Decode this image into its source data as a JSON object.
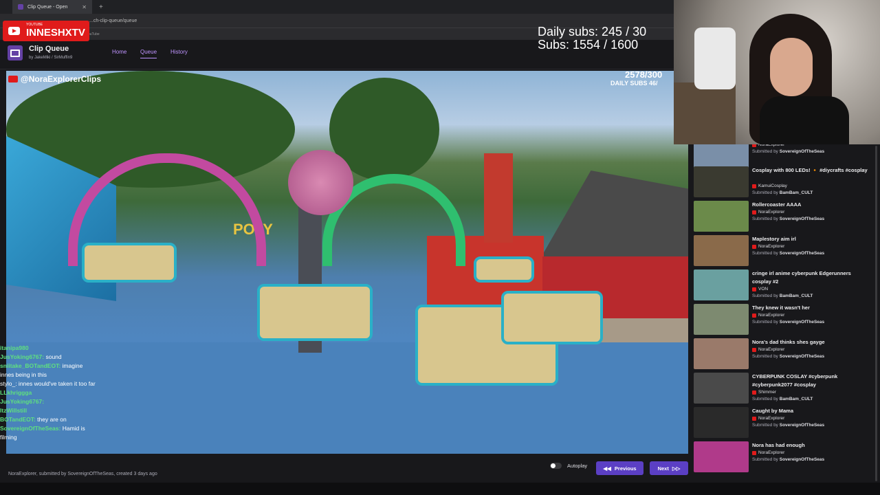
{
  "browser": {
    "tab_title": "Clip Queue - Open",
    "url": "...ch-clip-queue/queue",
    "bookmark": "YouTube"
  },
  "overlay": {
    "yt_small": "YOUTUBE",
    "yt_channel": "INNESHXTV",
    "daily_subs": "Daily subs: 245 / 30",
    "subs": "Subs: 1554 / 1600"
  },
  "app": {
    "title": "Clip Queue",
    "by_prefix": "by",
    "author1": "JakeMiki",
    "author2": "SirMuffin9",
    "nav": {
      "home": "Home",
      "queue": "Queue",
      "history": "History"
    }
  },
  "video": {
    "handle": "@NoraExplorerClips",
    "counter": "2578/300",
    "daily": "DAILY SUBS 46/",
    "sign": "POLY"
  },
  "chat": [
    {
      "user": "itanipa980",
      "text": ""
    },
    {
      "user": "JusYoking6767:",
      "text": "sound"
    },
    {
      "user": "sniitake_BOTandEOT:",
      "text": "imagine"
    },
    {
      "user": "",
      "text": "innes being in this"
    },
    {
      "user": "",
      "text": "stylo_: innes would've taken it too far"
    },
    {
      "user": "LLkhriggga",
      "text": ""
    },
    {
      "user": "JusYoking6767:",
      "text": ""
    },
    {
      "user": "ItzWillstill",
      "text": ""
    },
    {
      "user": "BOTandEOT:",
      "text": "they are on"
    },
    {
      "user": "SovereignOfTheSeas:",
      "text": "Hamid is"
    },
    {
      "user": "",
      "text": "filming"
    }
  ],
  "player": {
    "submitted_line": "NoraExplorer, submitted by SovereignOfTheSeas, created 3 days ago",
    "autoplay": "Autoplay",
    "previous": "Previous",
    "next": "Next"
  },
  "queue": [
    {
      "title": "",
      "channel": "NoraExplorer",
      "submitted_by": "SovereignOfTheSeas",
      "thumb": "#7a8fa8"
    },
    {
      "title": "Cosplay with 800 LEDs! 🔸 #diycrafts #cosplay",
      "channel": "KamuiCosplay",
      "submitted_by": "BamBam_CULT",
      "thumb": "#3a3a30"
    },
    {
      "title": "Rollercoaster AAAA",
      "channel": "NoraExplorer",
      "submitted_by": "SovereignOfTheSeas",
      "thumb": "#6b8a4a"
    },
    {
      "title": "Maplestory aim irl",
      "channel": "NoraExplorer",
      "submitted_by": "SovereignOfTheSeas",
      "thumb": "#8a6a4a"
    },
    {
      "title": "cringe irl anime cyberpunk Edgerunners cosplay #2",
      "channel": "VON",
      "submitted_by": "BamBam_CULT",
      "thumb": "#6aa0a0"
    },
    {
      "title": "They knew it wasn't her",
      "channel": "NoraExplorer",
      "submitted_by": "SovereignOfTheSeas",
      "thumb": "#7d8a70"
    },
    {
      "title": "Nora's dad thinks shes gayge",
      "channel": "NoraExplorer",
      "submitted_by": "SovereignOfTheSeas",
      "thumb": "#9a7a6a"
    },
    {
      "title": "CYBERPUNK COSLAY #cyberpunk #cyberpunk2077 #cosplay",
      "channel": "Shimmer",
      "submitted_by": "BamBam_CULT",
      "thumb": "#4a4a4a"
    },
    {
      "title": "Caught by Mama",
      "channel": "NoraExplorer",
      "submitted_by": "SovereignOfTheSeas",
      "thumb": "#2a2a2a"
    },
    {
      "title": "Nora has had enough",
      "channel": "NoraExplorer",
      "submitted_by": "SovereignOfTheSeas",
      "thumb": "#b03a8a"
    }
  ],
  "labels": {
    "submitted_by": "Submitted by"
  },
  "colors": {
    "accent": "#5b3fc4",
    "brand_red": "#e01b1b",
    "chat_user": "#5fe07f"
  }
}
